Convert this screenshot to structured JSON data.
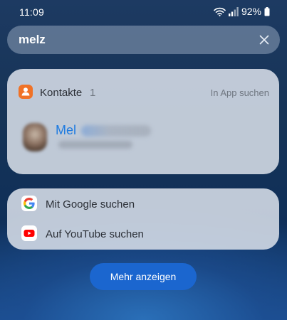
{
  "status_bar": {
    "time": "11:09",
    "battery_percent": "92%",
    "icons": [
      "wifi-icon",
      "signal-icon",
      "battery-icon"
    ]
  },
  "search": {
    "query": "melz",
    "clear_icon": "close-icon"
  },
  "contacts": {
    "icon": "person-icon",
    "title": "Kontakte",
    "count": "1",
    "search_in_app_label": "In App suchen",
    "results": [
      {
        "name_visible": "Mel",
        "name_obscured": true,
        "subtitle_obscured": true
      }
    ]
  },
  "web_search": {
    "items": [
      {
        "icon": "google-icon",
        "label": "Mit Google suchen"
      },
      {
        "icon": "youtube-icon",
        "label": "Auf YouTube suchen"
      }
    ]
  },
  "more_button": {
    "label": "Mehr anzeigen"
  },
  "colors": {
    "accent_blue": "#1b66cf",
    "contact_name_blue": "#1e7be0",
    "contacts_orange": "#f07227",
    "youtube_red": "#ff0000"
  }
}
